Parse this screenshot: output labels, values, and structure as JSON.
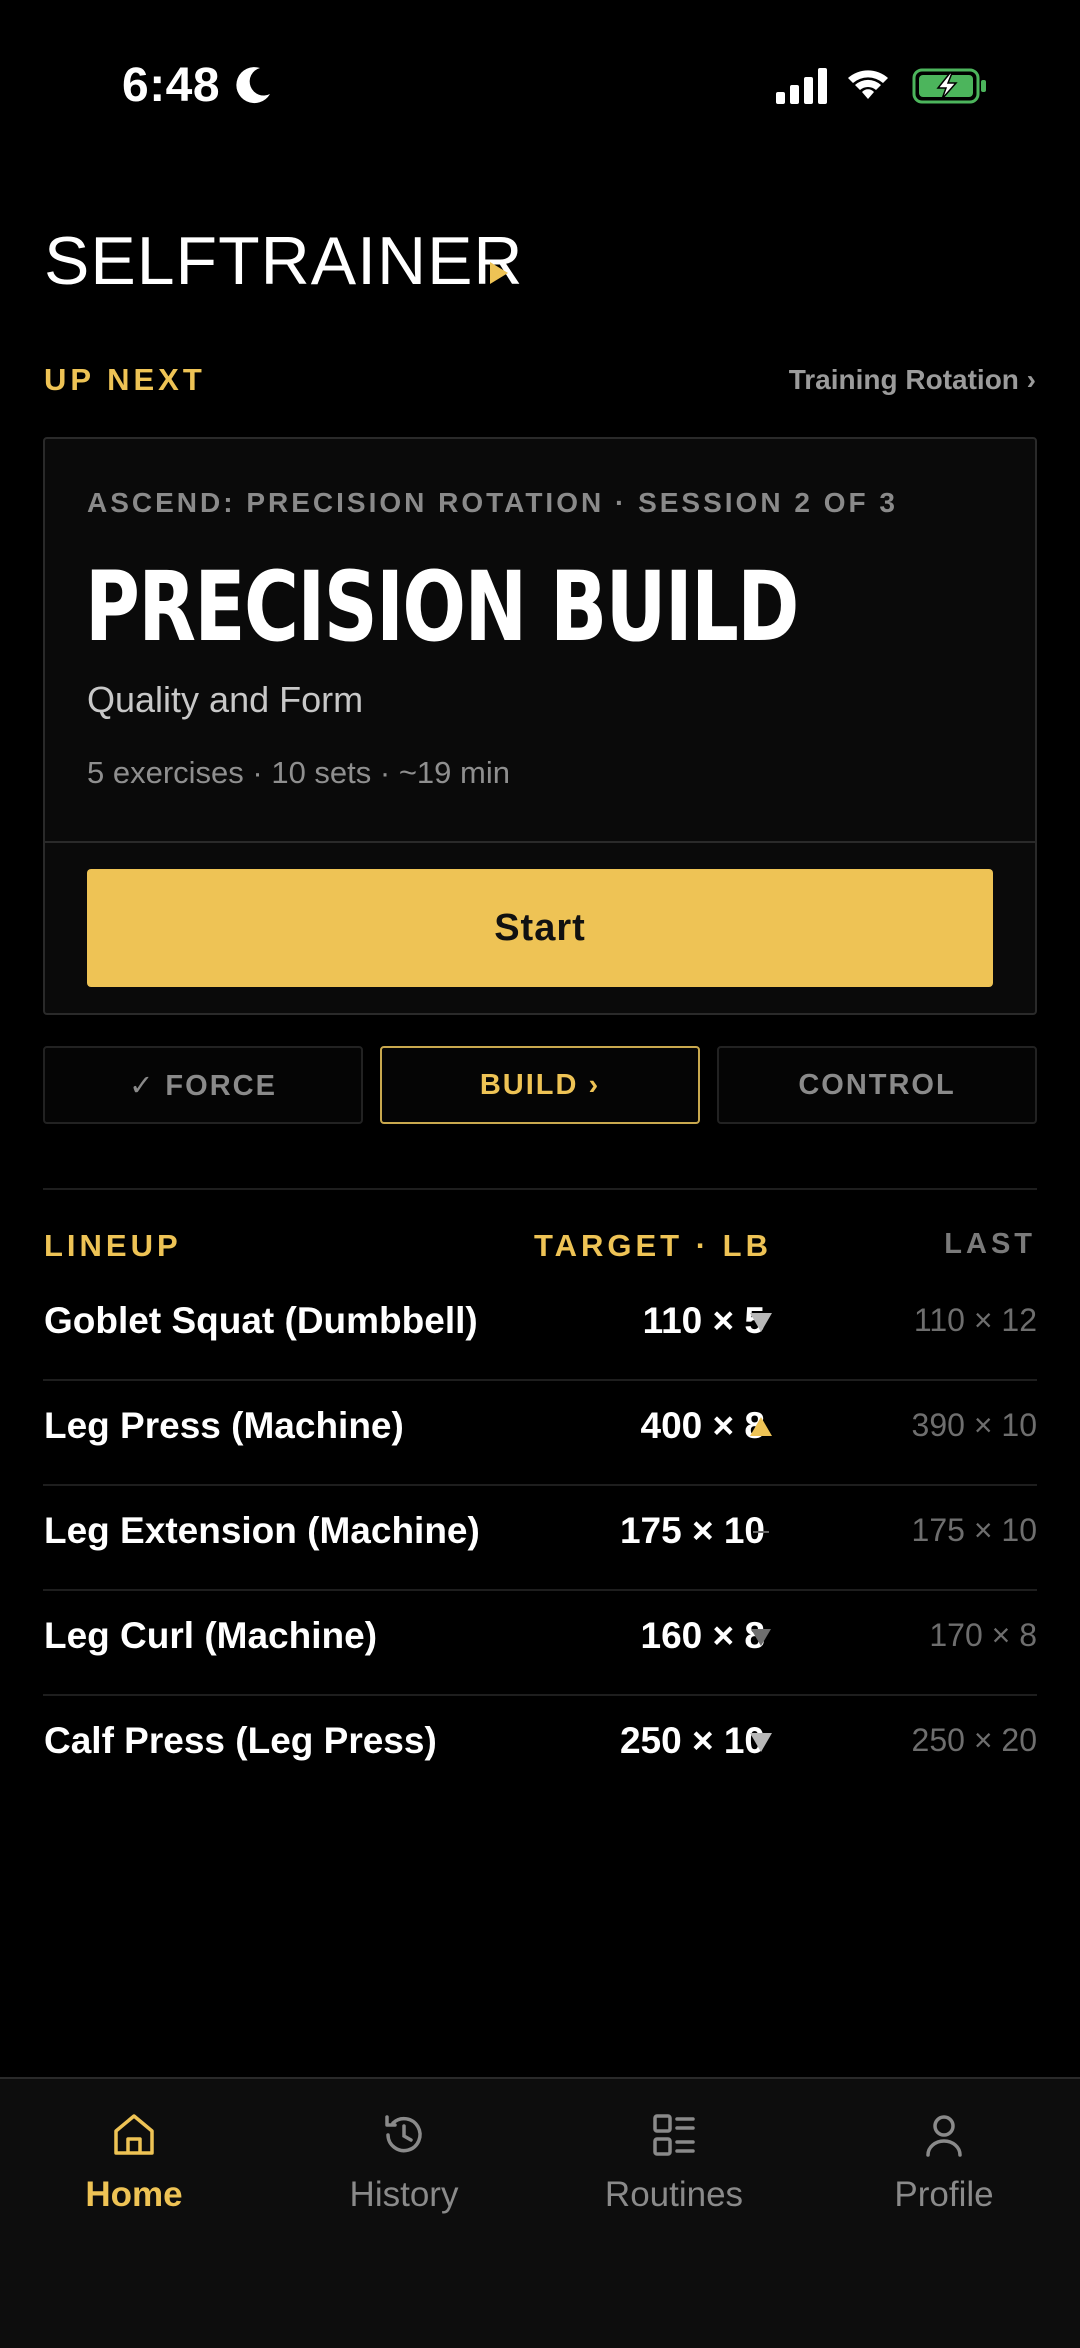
{
  "status_bar": {
    "time": "6:48",
    "icons": [
      "moon-icon",
      "signal-icon",
      "wifi-icon",
      "battery-charging-icon"
    ]
  },
  "header": {
    "app_title": "SELFTRAINER"
  },
  "up_next": {
    "label": "UP NEXT",
    "rotation_link": "Training Rotation ›"
  },
  "session": {
    "meta": "ASCEND: PRECISION ROTATION · SESSION 2 OF 3",
    "title": "PRECISION BUILD",
    "subtitle": "Quality and Form",
    "stats": "5 exercises · 10 sets · ~19 min",
    "start_label": "Start"
  },
  "phase_tabs": [
    {
      "label": "✓ FORCE",
      "state": "completed"
    },
    {
      "label": "BUILD ›",
      "state": "active"
    },
    {
      "label": "CONTROL",
      "state": "upcoming"
    }
  ],
  "lineup": {
    "label": "LINEUP",
    "target_header": "TARGET · LB",
    "last_header": "LAST",
    "rows": [
      {
        "name": "Goblet Squat (Dumbbell)",
        "target": "110 × 5",
        "trend": "down",
        "last": "110 × 12"
      },
      {
        "name": "Leg Press (Machine)",
        "target": "400 × 8",
        "trend": "up",
        "last": "390 × 10"
      },
      {
        "name": "Leg Extension (Machine)",
        "target": "175 × 10",
        "trend": "same",
        "last": "175 × 10"
      },
      {
        "name": "Leg Curl (Machine)",
        "target": "160 × 8",
        "trend": "down-dim",
        "last": "170 × 8"
      },
      {
        "name": "Calf Press (Leg Press)",
        "target": "250 × 10",
        "trend": "down",
        "last": "250 × 20"
      }
    ]
  },
  "bottom_nav": {
    "items": [
      {
        "label": "Home",
        "icon": "home-icon",
        "active": true
      },
      {
        "label": "History",
        "icon": "history-icon",
        "active": false
      },
      {
        "label": "Routines",
        "icon": "routines-icon",
        "active": false
      },
      {
        "label": "Profile",
        "icon": "profile-icon",
        "active": false
      }
    ]
  },
  "colors": {
    "accent": "#EEC355",
    "background": "#000000",
    "card": "#0a0a0a",
    "muted": "#8a8a8a"
  }
}
